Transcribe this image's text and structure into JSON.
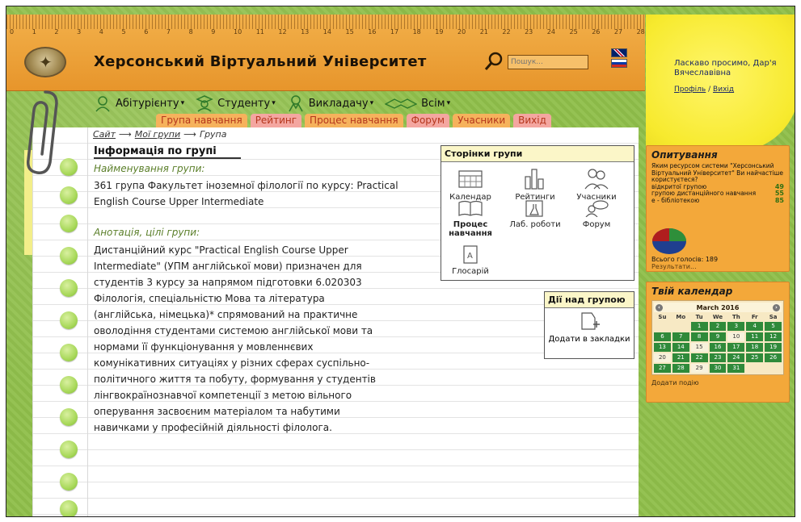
{
  "header": {
    "site_title": "Херсонський Віртуальний Університет",
    "ruler_numbers": [
      "0",
      "1",
      "2",
      "3",
      "4",
      "5",
      "6",
      "7",
      "8",
      "9",
      "10",
      "11",
      "12",
      "13",
      "14",
      "15",
      "16",
      "17",
      "18",
      "19",
      "20",
      "21",
      "22",
      "23",
      "24",
      "25",
      "26",
      "27",
      "28"
    ],
    "search_placeholder": "Пошук..."
  },
  "user": {
    "welcome": "Ласкаво просимо, Дар'я Вячеславівна",
    "profile_link": "Профіль",
    "separator": "/",
    "logout_link": "Вихід"
  },
  "role_nav": [
    {
      "label": "Абітурієнту"
    },
    {
      "label": "Студенту"
    },
    {
      "label": "Викладачу"
    },
    {
      "label": "Всім"
    }
  ],
  "tabs": [
    {
      "label": "Група навчання",
      "color": "orange"
    },
    {
      "label": "Рейтинг",
      "color": "pink"
    },
    {
      "label": "Процес навчання",
      "color": "orange"
    },
    {
      "label": "Форум",
      "color": "pink"
    },
    {
      "label": "Учасники",
      "color": "orange"
    },
    {
      "label": "Вихід",
      "color": "pink"
    }
  ],
  "breadcrumb": {
    "site": "Сайт",
    "my_groups": "Мої групи",
    "current": "Група"
  },
  "main": {
    "info_title": "Інформація по групі",
    "name_label": "Найменування групи:",
    "group_name": "361 група Факультет іноземної філології по курсу: Practical English Course Upper Intermediate",
    "annotation_label": "Анотація, цілі групи:",
    "annotation_lines": [
      "Дистанційний курс \"Practical English Course Upper",
      "Intermediate\" (УПМ англійської мови) призначен для",
      "студентів 3 курсу за напрямом підготовки 6.020303",
      "Філологія, спеціальністю Мова та література",
      "(англійська, німецька)* спрямований на практичне",
      "оволодіння студентами системою англійської мови та",
      "нормами її функціонування у мовленнєвих",
      "комунікативних ситуаціях у різних сферах суспільно-",
      "політичного життя та побуту, формування у студентів",
      "лінгвокраїнознавчої компетенції з метою вільного",
      "оперування засвоєним матеріалом та набутими",
      "навичками у професійній діяльності філолога."
    ]
  },
  "group_pages": {
    "title": "Сторінки групи",
    "items": [
      {
        "label": "Календар",
        "icon": "calendar-icon"
      },
      {
        "label": "Рейтинги",
        "icon": "bar-chart-icon"
      },
      {
        "label": "Учасники",
        "icon": "participants-icon"
      },
      {
        "label": "Процес навчання",
        "icon": "book-icon"
      },
      {
        "label": "Лаб. роботи",
        "icon": "flask-icon"
      },
      {
        "label": "Форум",
        "icon": "forum-icon"
      },
      {
        "label": "Глосарій",
        "icon": "glossary-icon"
      }
    ]
  },
  "group_actions": {
    "title": "Дії над групою",
    "bookmark_label": "Додати в закладки"
  },
  "poll": {
    "title": "Опитування",
    "question": "Яким ресурсом системи \"Херсонський Віртуальний Університет\" Ви найчастіше користуєтеся?",
    "options": [
      {
        "label": "відкритої групою",
        "value": "49"
      },
      {
        "label": "групою дистанційного навчання",
        "value": "55"
      },
      {
        "label": "е - бібліотекою",
        "value": "85"
      }
    ],
    "total": "Всього голосів: 189",
    "results_link": "Результати..."
  },
  "calendar": {
    "title": "Твій календар",
    "month": "March 2016",
    "weekdays": [
      "Su",
      "Mo",
      "Tu",
      "We",
      "Th",
      "Fr",
      "Sa"
    ],
    "leading_blanks": 2,
    "days": [
      "1",
      "2",
      "3",
      "4",
      "5",
      "6",
      "7",
      "8",
      "9",
      "10",
      "11",
      "12",
      "13",
      "14",
      "15",
      "16",
      "17",
      "18",
      "19",
      "20",
      "21",
      "22",
      "23",
      "24",
      "25",
      "26",
      "27",
      "28",
      "29",
      "30",
      "31"
    ],
    "light_days": [
      "10",
      "15",
      "20",
      "29"
    ],
    "add_event": "Додати подію"
  },
  "colors": {
    "background": "#8fbf4a",
    "ruler": "#f2b04a",
    "sticky_note": "#f7ea2e",
    "side_panel": "#f3a83a",
    "tab_text": "#b5361c",
    "calendar_day": "#2f8a3a",
    "label_green": "#5b7f2a"
  }
}
